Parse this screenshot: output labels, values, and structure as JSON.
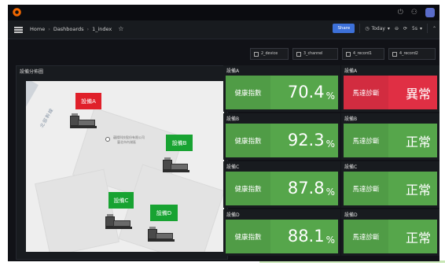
{
  "nav": {
    "breadcrumbs": [
      "Home",
      "Dashboards",
      "1_index"
    ],
    "share_label": "Share",
    "time_label": "Today",
    "refresh_label": "5s"
  },
  "variables": [
    {
      "label": "2_device"
    },
    {
      "label": "3_channel"
    },
    {
      "label": "4_record1"
    },
    {
      "label": "4_record2"
    }
  ],
  "map_panel": {
    "title": "設備分佈圖",
    "road_label": "北部幹線",
    "company_line1": "蘊揚科技股份有限公司",
    "company_line2": "臺北市內湖區",
    "devices": [
      {
        "label": "設備A"
      },
      {
        "label": "設備B"
      },
      {
        "label": "設備C"
      },
      {
        "label": "設備D"
      }
    ]
  },
  "health_tiles": [
    {
      "title": "設備A",
      "label": "健康指數",
      "value": "70.4",
      "unit": "%"
    },
    {
      "title": "設備B",
      "label": "健康指數",
      "value": "92.3",
      "unit": "%"
    },
    {
      "title": "設備C",
      "label": "健康指數",
      "value": "87.8",
      "unit": "%"
    },
    {
      "title": "設備D",
      "label": "健康指數",
      "value": "88.1",
      "unit": "%"
    }
  ],
  "status_tiles": [
    {
      "title": "設備A",
      "label": "馬達診斷",
      "value": "異常",
      "state": "alert"
    },
    {
      "title": "設備B",
      "label": "馬達診斷",
      "value": "正常",
      "state": "ok"
    },
    {
      "title": "設備C",
      "label": "馬達診斷",
      "value": "正常",
      "state": "ok"
    },
    {
      "title": "設備D",
      "label": "馬達診斷",
      "value": "正常",
      "state": "ok"
    }
  ],
  "colors": {
    "ok": "#56a64b",
    "alert": "#e02f44",
    "device_label": "#18a332",
    "device_label_alert": "#e0202a",
    "share": "#3d71d9"
  },
  "icons": [
    "grafana-logo-icon",
    "help-icon",
    "user-icon",
    "avatar-icon",
    "menu-icon",
    "star-icon",
    "clock-icon",
    "zoom-out-icon",
    "refresh-icon",
    "chevron-up-icon"
  ]
}
